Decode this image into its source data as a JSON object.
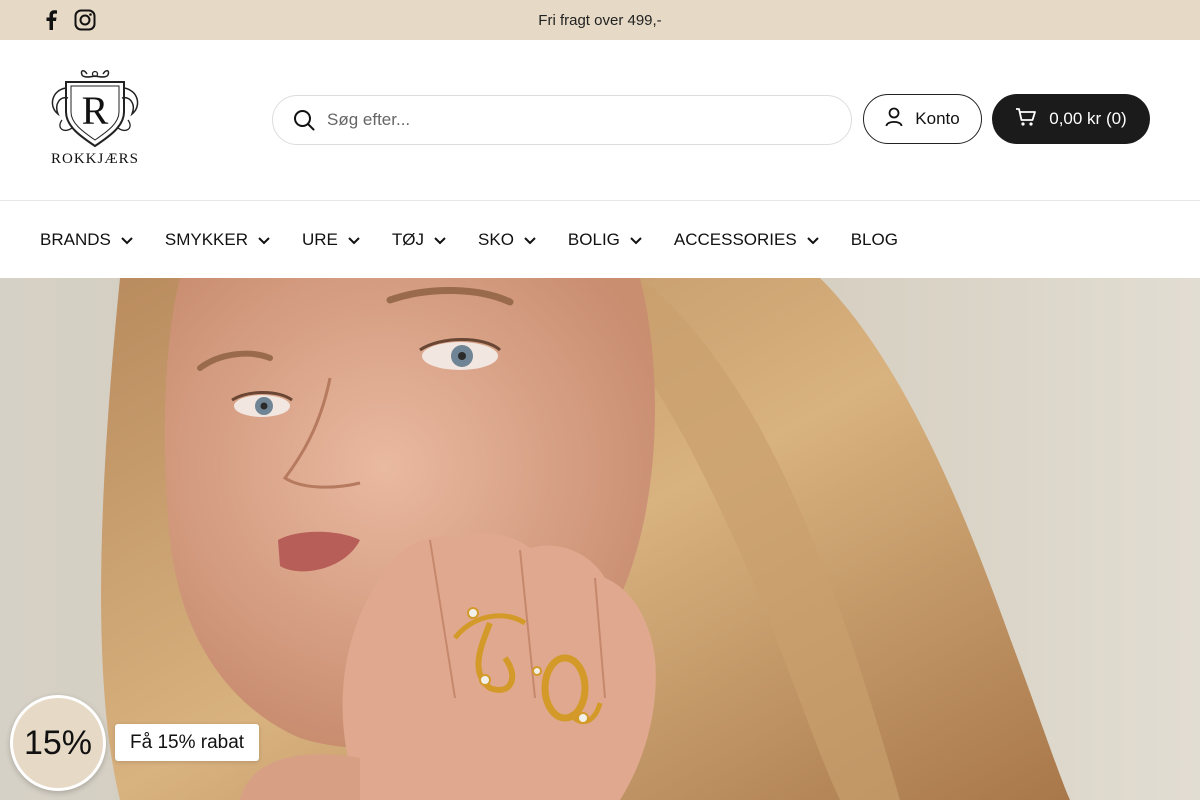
{
  "announcement": {
    "text": "Fri fragt over 499,-",
    "socials": [
      "facebook-icon",
      "instagram-icon"
    ]
  },
  "header": {
    "logo_text": "ROKKJÆRS",
    "logo_letter": "R",
    "search": {
      "placeholder": "Søg efter..."
    },
    "account_label": "Konto",
    "cart_label": "0,00 kr (0)"
  },
  "nav": {
    "items": [
      {
        "label": "BRANDS",
        "dropdown": true
      },
      {
        "label": "SMYKKER",
        "dropdown": true
      },
      {
        "label": "URE",
        "dropdown": true
      },
      {
        "label": "TØJ",
        "dropdown": true
      },
      {
        "label": "SKO",
        "dropdown": true
      },
      {
        "label": "BOLIG",
        "dropdown": true
      },
      {
        "label": "ACCESSORIES",
        "dropdown": true
      },
      {
        "label": "BLOG",
        "dropdown": false
      }
    ]
  },
  "hero": {
    "image": "woman-with-gold-rings"
  },
  "discount": {
    "badge": "15%",
    "label": "Få 15% rabat"
  },
  "colors": {
    "announcement_bg": "#e6dac6",
    "cart_bg": "#1b1b1b",
    "badge_bg": "#e6dac6"
  }
}
